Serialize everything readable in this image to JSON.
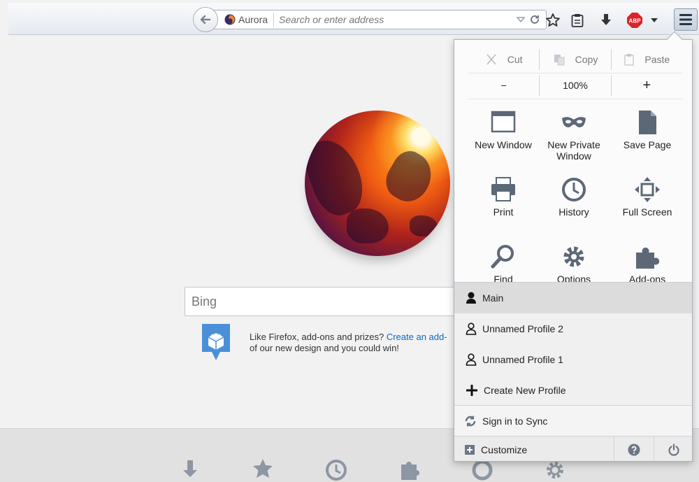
{
  "toolbar": {
    "identity_label": "Aurora",
    "url_placeholder": "Search or enter address"
  },
  "page": {
    "search_placeholder": "Bing",
    "snippet_text": "Like Firefox, add-ons and prizes? ",
    "snippet_link": "Create an add-",
    "snippet_text_2": "of our new design and you could win!"
  },
  "menu": {
    "edit": {
      "cut": "Cut",
      "copy": "Copy",
      "paste": "Paste"
    },
    "zoom": {
      "out": "−",
      "level": "100%",
      "in": "+"
    },
    "grid": [
      {
        "label": "New Window",
        "icon": "window-icon"
      },
      {
        "label": "New Private Window",
        "icon": "mask-icon"
      },
      {
        "label": "Save Page",
        "icon": "page-icon"
      },
      {
        "label": "Print",
        "icon": "printer-icon"
      },
      {
        "label": "History",
        "icon": "clock-icon"
      },
      {
        "label": "Full Screen",
        "icon": "fullscreen-icon"
      },
      {
        "label": "Find",
        "icon": "magnifier-icon"
      },
      {
        "label": "Options",
        "icon": "gear-icon"
      },
      {
        "label": "Add-ons",
        "icon": "puzzle-icon"
      }
    ],
    "profiles": [
      {
        "label": "Main",
        "active": true
      },
      {
        "label": "Unnamed Profile 2",
        "active": false
      },
      {
        "label": "Unnamed Profile 1",
        "active": false
      }
    ],
    "create_profile": "Create New Profile",
    "sync": "Sign in to Sync",
    "customize": "Customize"
  },
  "colors": {
    "link": "#0a6bc4",
    "accent": "#4a90d9",
    "adblock": "#d7262a"
  }
}
